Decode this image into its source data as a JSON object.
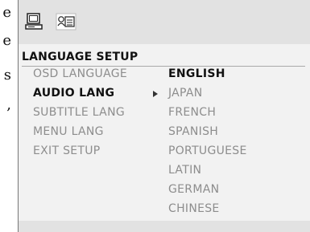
{
  "edge_text": [
    "e",
    "e",
    "s",
    ","
  ],
  "toolbar": {
    "icons": [
      "computer-icon",
      "language-icon"
    ]
  },
  "menu": {
    "title": "LANGUAGE SETUP",
    "left_items": [
      {
        "label": "OSD LANGUAGE",
        "active": false
      },
      {
        "label": "AUDIO LANG",
        "active": true
      },
      {
        "label": "SUBTITLE LANG",
        "active": false
      },
      {
        "label": "MENU LANG",
        "active": false
      },
      {
        "label": "EXIT SETUP",
        "active": false
      }
    ],
    "options": [
      {
        "label": "ENGLISH",
        "selected": true
      },
      {
        "label": "JAPAN",
        "selected": false
      },
      {
        "label": "FRENCH",
        "selected": false
      },
      {
        "label": "SPANISH",
        "selected": false
      },
      {
        "label": "PORTUGUESE",
        "selected": false
      },
      {
        "label": "LATIN",
        "selected": false
      },
      {
        "label": "GERMAN",
        "selected": false
      },
      {
        "label": "CHINESE",
        "selected": false
      }
    ]
  },
  "colors": {
    "panel_bg": "#f2f2f2",
    "bar_bg": "#e2e2e2",
    "active_text": "#111111",
    "inactive_text": "#8d8d8d"
  }
}
